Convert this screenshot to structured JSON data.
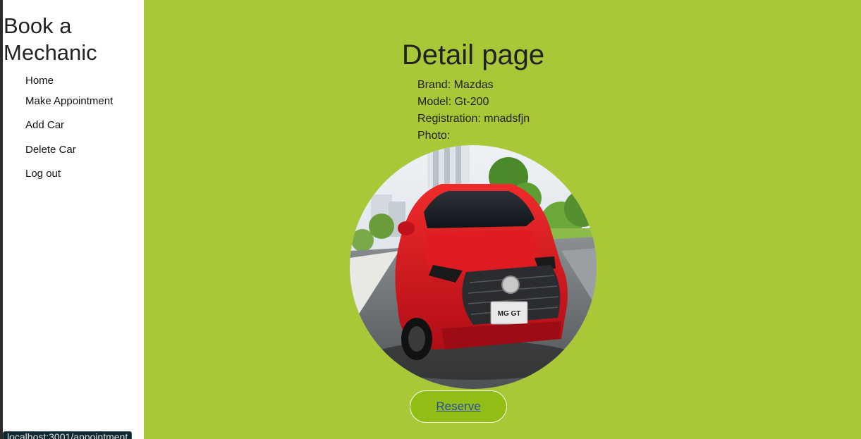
{
  "sidebar": {
    "brand_line1": "Book a",
    "brand_line2": "Mechanic",
    "items": [
      {
        "label": "Home"
      },
      {
        "label": "Make Appointment"
      },
      {
        "label": "Add Car"
      },
      {
        "label": "Delete Car"
      },
      {
        "label": "Log out"
      }
    ]
  },
  "main": {
    "title": "Detail page",
    "brand_label": "Brand:",
    "brand_value": "Mazdas",
    "model_label": "Model:",
    "model_value": "Gt-200",
    "registration_label": "Registration:",
    "registration_value": "mnadsfjn",
    "photo_label": "Photo:",
    "plate_text": "MG GT",
    "reserve_label": "Reserve"
  },
  "status_url": "localhost:3001/appointment",
  "colors": {
    "background": "#a8c838",
    "sidebar": "#ffffff",
    "button": "#92bd14",
    "car_body": "#d8141e"
  }
}
